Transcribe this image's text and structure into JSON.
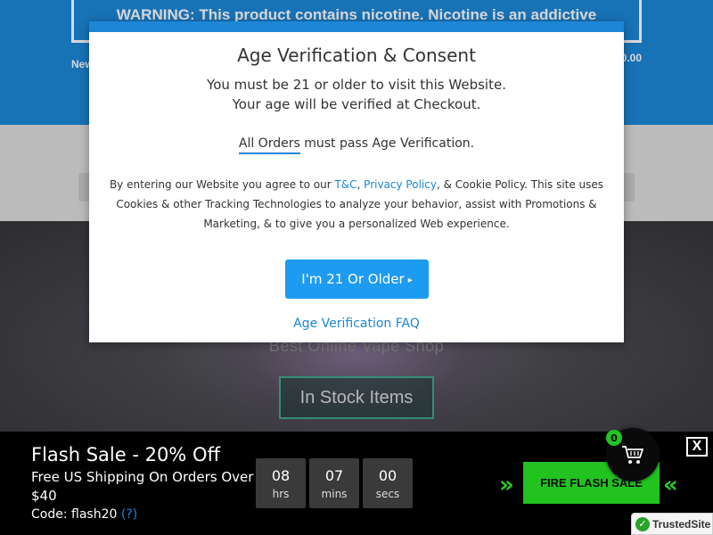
{
  "banner": {
    "warning": "WARNING: This product contains nicotine. Nicotine is an addictive",
    "left_text": "New",
    "right_text": "0.00"
  },
  "hero": {
    "subtitle": "Best Online Vape Shop",
    "button_label": "In Stock Items"
  },
  "modal": {
    "title": "Age Verification & Consent",
    "line1": "You must be 21 or older to visit this Website.",
    "line2": "Your age will be verified at Checkout.",
    "orders_link": "All Orders",
    "orders_rest": " must pass Age Verification.",
    "consent_pre": "By entering our Website you agree to our ",
    "tc_link": "T&C",
    "comma": ", ",
    "privacy_link": "Privacy Policy",
    "consent_post": ", & Cookie Policy. This site uses Cookies & other Tracking Technologies to analyze your behavior, assist with Promotions & Marketing, & to give you a personalized Web experience.",
    "verify_button": "I'm 21 Or Older",
    "faq_link": "Age Verification FAQ",
    "accent_color": "#1d86d6"
  },
  "sale": {
    "title": "Flash Sale - 20% Off",
    "description": "Free US Shipping On Orders Over $40",
    "code_label": "Code: flash20",
    "code_help": "(?)",
    "countdown": [
      {
        "value": "08",
        "unit": "hrs"
      },
      {
        "value": "07",
        "unit": "mins"
      },
      {
        "value": "00",
        "unit": "secs"
      }
    ],
    "fire_button": "FIRE FLASH SALE",
    "accent_color": "#22c31f"
  },
  "cart": {
    "count": "0",
    "icon": "cart-icon"
  },
  "close_label": "X",
  "trusted_site": "TrustedSite"
}
